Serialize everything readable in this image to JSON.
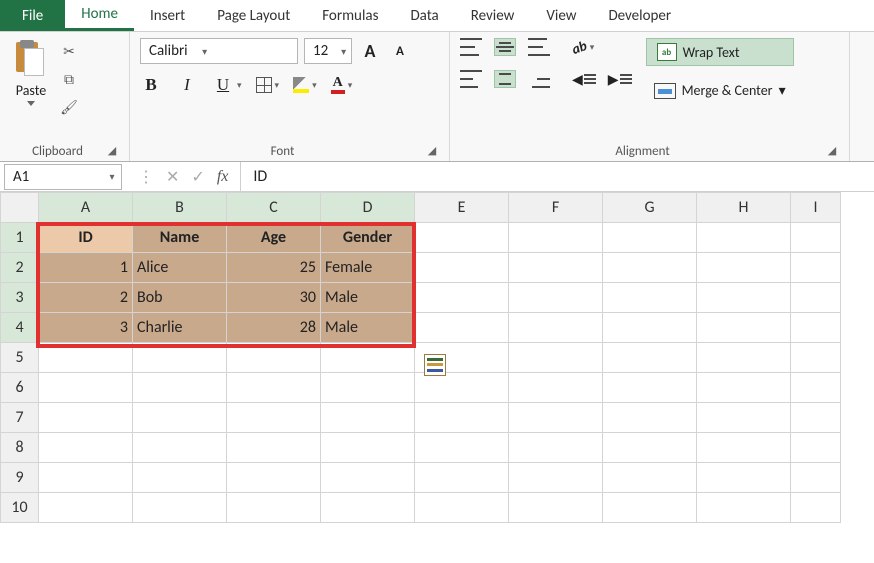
{
  "tabs": {
    "file": "File",
    "home": "Home",
    "insert": "Insert",
    "pageLayout": "Page Layout",
    "formulas": "Formulas",
    "data": "Data",
    "review": "Review",
    "view": "View",
    "developer": "Developer"
  },
  "ribbon": {
    "clipboard": {
      "paste": "Paste",
      "label": "Clipboard"
    },
    "font": {
      "name": "Calibri",
      "size": "12",
      "grow": "A",
      "shrink": "A",
      "bold": "B",
      "italic": "I",
      "underline": "U",
      "fontcolor": "A",
      "label": "Font"
    },
    "alignment": {
      "wrap": "Wrap Text",
      "merge": "Merge & Center",
      "label": "Alignment"
    }
  },
  "formulaBar": {
    "nameBox": "A1",
    "value": "ID"
  },
  "columns": [
    "A",
    "B",
    "C",
    "D",
    "E",
    "F",
    "G",
    "H",
    "I"
  ],
  "rows": [
    "1",
    "2",
    "3",
    "4",
    "5",
    "6",
    "7",
    "8",
    "9",
    "10"
  ],
  "chart_data": {
    "type": "table",
    "headers": [
      "ID",
      "Name",
      "Age",
      "Gender"
    ],
    "rows": [
      {
        "ID": 1,
        "Name": "Alice",
        "Age": 25,
        "Gender": "Female"
      },
      {
        "ID": 2,
        "Name": "Bob",
        "Age": 30,
        "Gender": "Male"
      },
      {
        "ID": 3,
        "Name": "Charlie",
        "Age": 28,
        "Gender": "Male"
      }
    ]
  }
}
